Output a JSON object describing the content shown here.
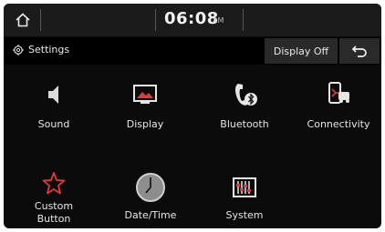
{
  "status_bar": {
    "time": "06:08",
    "ampm": "AM"
  },
  "header": {
    "title": "Settings",
    "display_off_label": "Display Off"
  },
  "menu": {
    "items": [
      {
        "label": "Sound",
        "icon": "speaker-icon"
      },
      {
        "label": "Display",
        "icon": "display-icon"
      },
      {
        "label": "Bluetooth",
        "icon": "bluetooth-phone-icon"
      },
      {
        "label": "Connectivity",
        "icon": "connectivity-icon"
      },
      {
        "label": "Custom Button",
        "icon": "star-icon"
      },
      {
        "label": "Date/Time",
        "icon": "clock-icon"
      },
      {
        "label": "System",
        "icon": "equalizer-icon"
      }
    ]
  },
  "colors": {
    "accent_red": "#e53935",
    "background": "#0b0b0b",
    "bar": "#1b1b1b"
  }
}
